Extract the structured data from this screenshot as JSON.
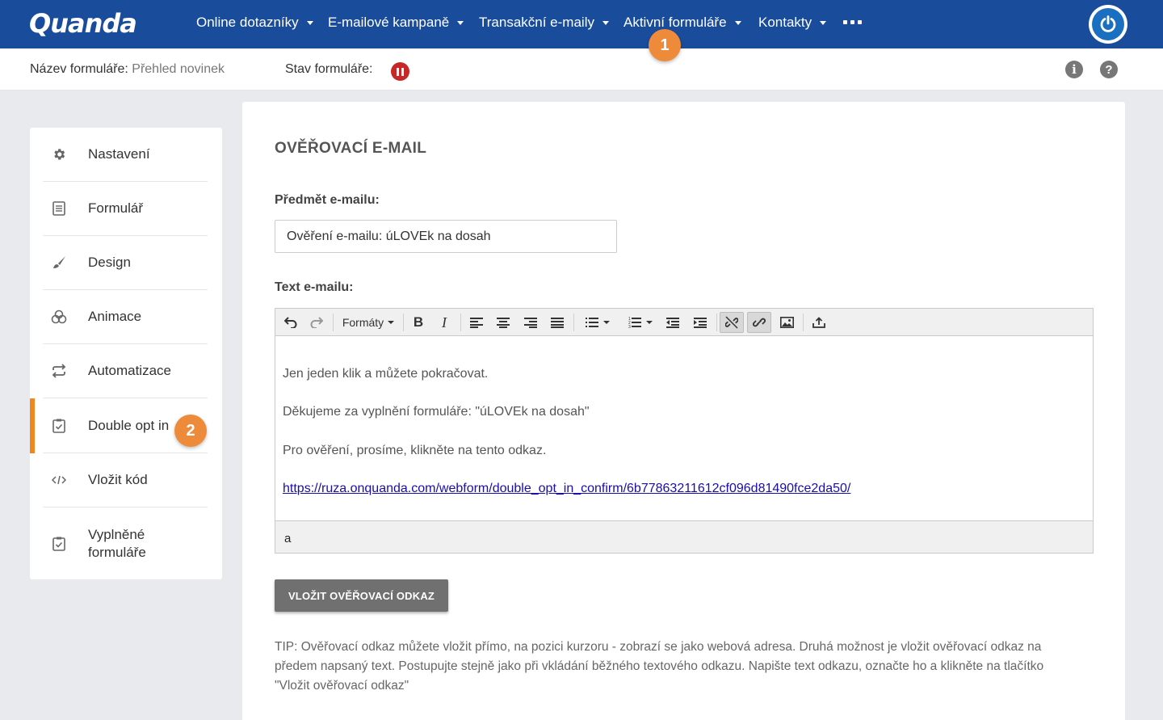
{
  "app": {
    "logo_text": "Quanda",
    "nav": [
      {
        "label": "Online dotazníky"
      },
      {
        "label": "E-mailové kampaně"
      },
      {
        "label": "Transakční e-maily"
      },
      {
        "label": "Aktivní formuláře"
      },
      {
        "label": "Kontakty"
      }
    ],
    "accent_color": "#1a4c9c",
    "badge_color": "#ee8b3a"
  },
  "badges": {
    "nav": "1",
    "sidebar": "2"
  },
  "subheader": {
    "form_name_label": "Název formuláře:",
    "form_name_value": "Přehled novinek",
    "form_status_label": "Stav formuláře:",
    "status_icon": "pause-icon",
    "info_icon": "i",
    "help_icon": "?"
  },
  "sidebar": {
    "active_index": 5,
    "items": [
      {
        "label": "Nastavení",
        "icon": "gear-icon"
      },
      {
        "label": "Formulář",
        "icon": "form-icon"
      },
      {
        "label": "Design",
        "icon": "brush-icon"
      },
      {
        "label": "Animace",
        "icon": "animation-icon"
      },
      {
        "label": "Automatizace",
        "icon": "repeat-icon"
      },
      {
        "label": "Double opt in",
        "icon": "checklist-icon"
      },
      {
        "label": "Vložit kód",
        "icon": "code-icon"
      },
      {
        "label": "Vyplněné formuláře",
        "icon": "checklist-icon"
      }
    ]
  },
  "main": {
    "title": "OVĚŘOVACÍ E-MAIL",
    "subject_label": "Předmět e-mailu:",
    "subject_value": "Ověření e-mailu: úLOVEk na dosah",
    "text_label": "Text e-mailu:",
    "toolbar": {
      "formats_label": "Formáty"
    },
    "body": {
      "line1": "Jen jeden klik a můžete pokračovat.",
      "line2": "Děkujeme za vyplnění formuláře: \"úLOVEk na dosah\"",
      "line3": "Pro ověření, prosíme, klikněte na tento odkaz.",
      "link": "https://ruza.onquanda.com/webform/double_opt_in_confirm/6b77863211612cf096d81490fce2da50/"
    },
    "statusbar_text": "a",
    "verify_button": "VLOŽIT OVĚŘOVACÍ ODKAZ",
    "tip": "TIP: Ověřovací odkaz můžete vložit přímo, na pozici kurzoru - zobrazí se jako webová adresa. Druhá možnost je vložit ověřovací odkaz na předem napsaný text. Postupujte stejně jako při vkládání běžného textového odkazu. Napište text odkazu, označte ho a klikněte na tlačítko \"Vložit ověřovací odkaz\""
  }
}
